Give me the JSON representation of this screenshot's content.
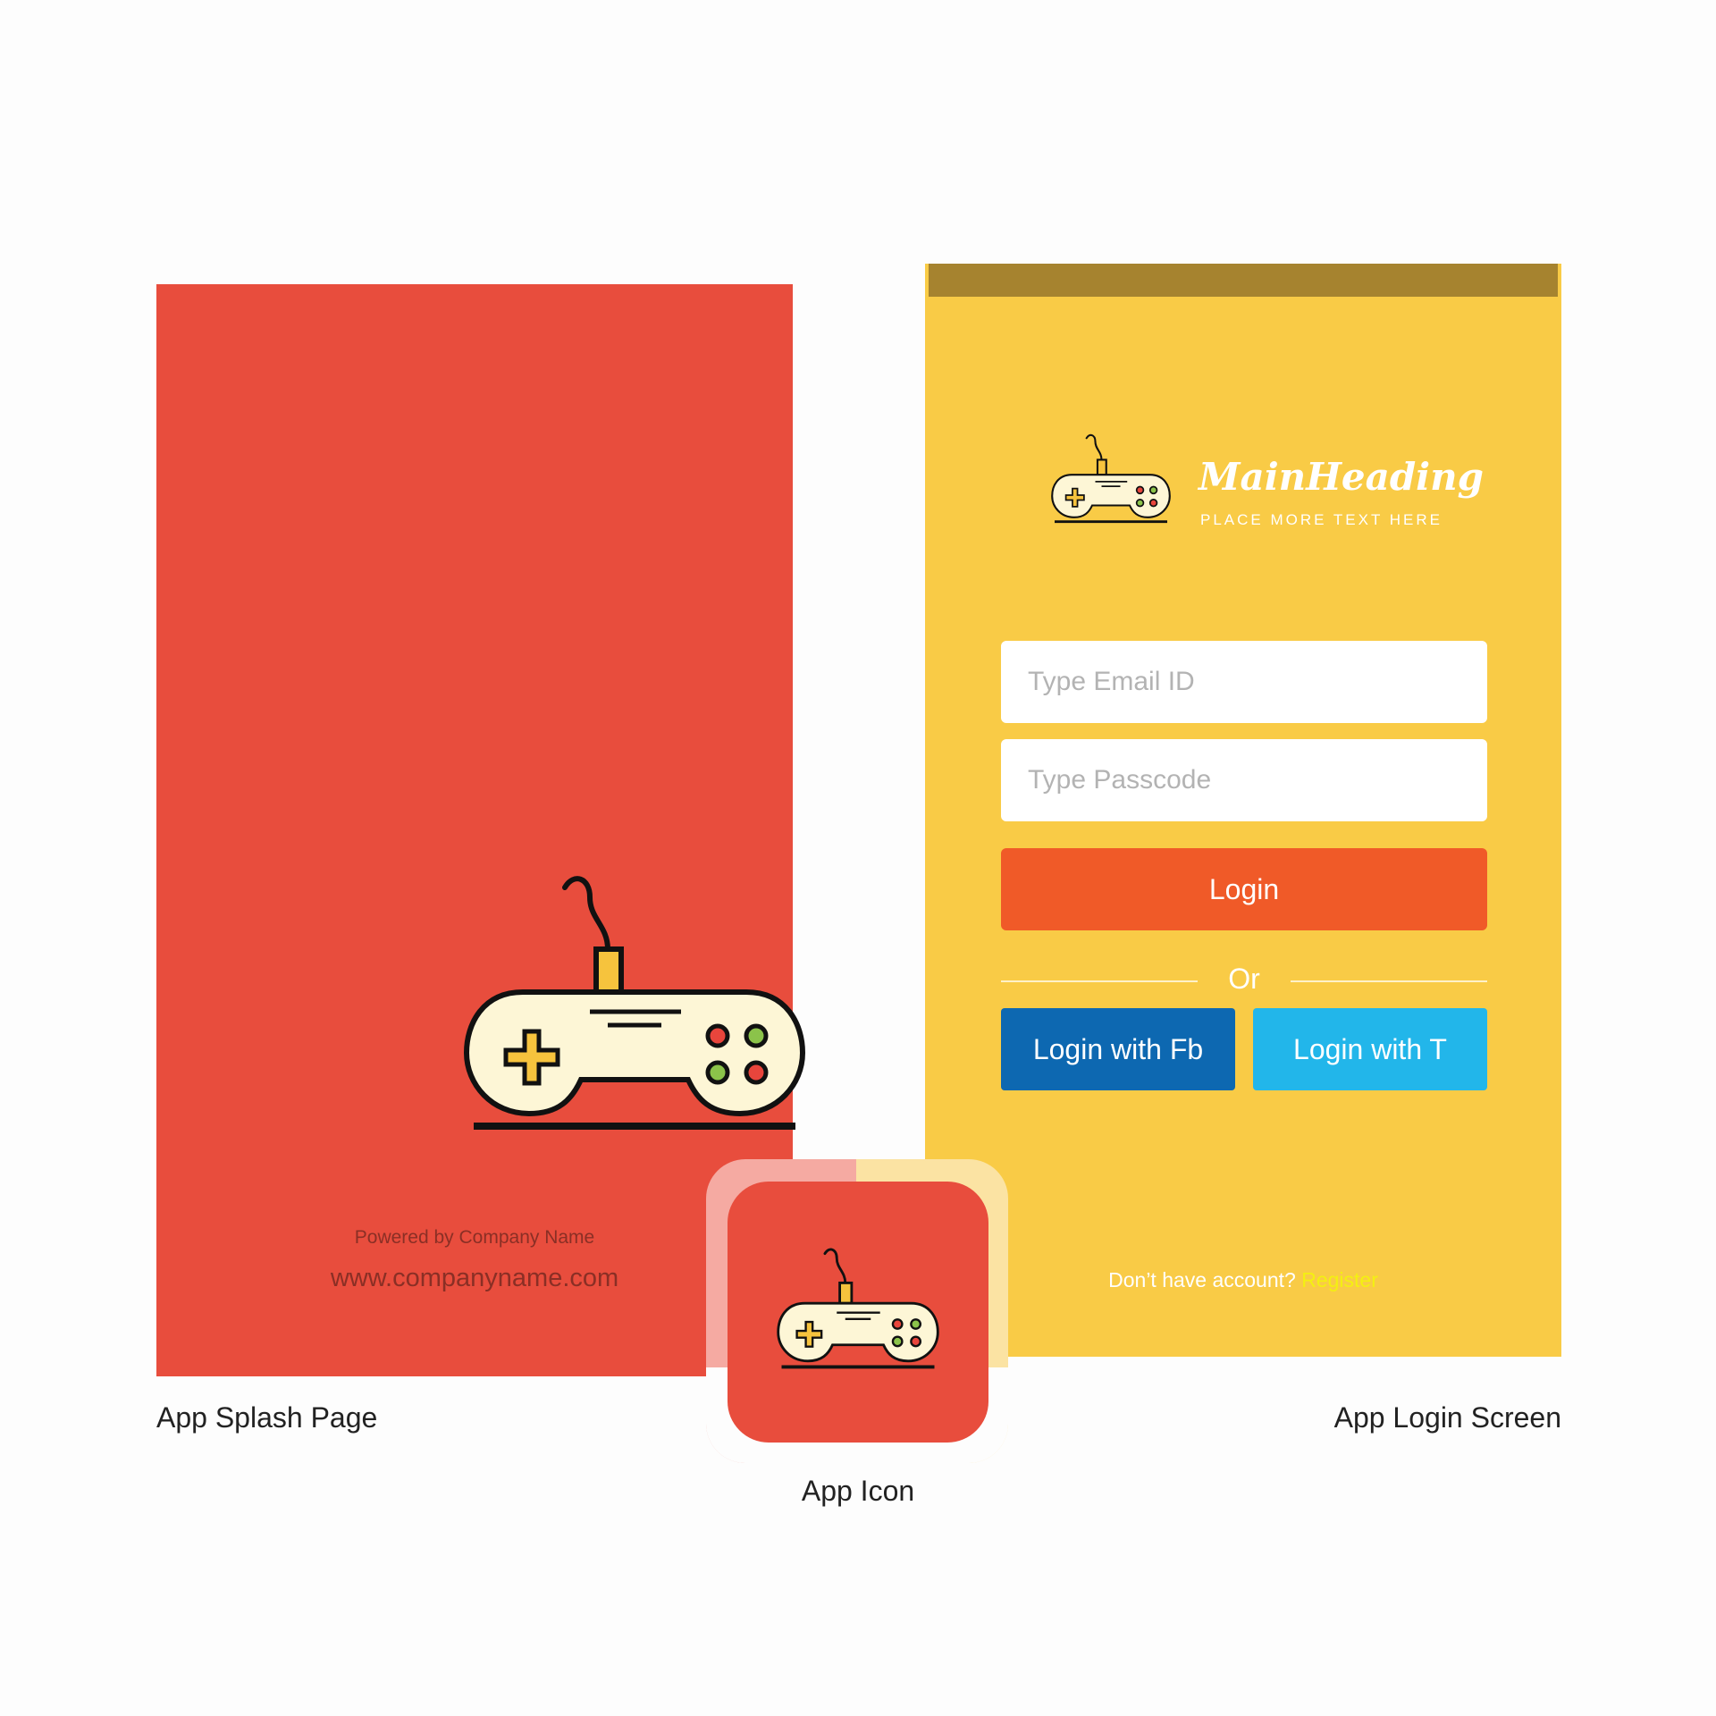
{
  "splash": {
    "powered_by": "Powered by Company Name",
    "website": "www.companyname.com",
    "caption": "App Splash Page",
    "background": "#e84d3d",
    "logo_icon": "gamepad-icon"
  },
  "login": {
    "heading": "MainHeading",
    "tagline": "PLACE MORE TEXT HERE",
    "email_placeholder": "Type Email ID",
    "passcode_placeholder": "Type Passcode",
    "login_label": "Login",
    "divider_text": "Or",
    "fb_label": "Login with Fb",
    "twitter_label": "Login with T",
    "no_account_text": "Don’t have account?",
    "register_label": "Register",
    "caption": "App Login Screen",
    "background": "#f9cb46",
    "topbar_color": "#a6832f",
    "login_button_color": "#f05a28",
    "fb_color": "#0d68b1",
    "twitter_color": "#22b6ea"
  },
  "app_icon": {
    "caption": "App Icon",
    "icon": "gamepad-icon"
  }
}
